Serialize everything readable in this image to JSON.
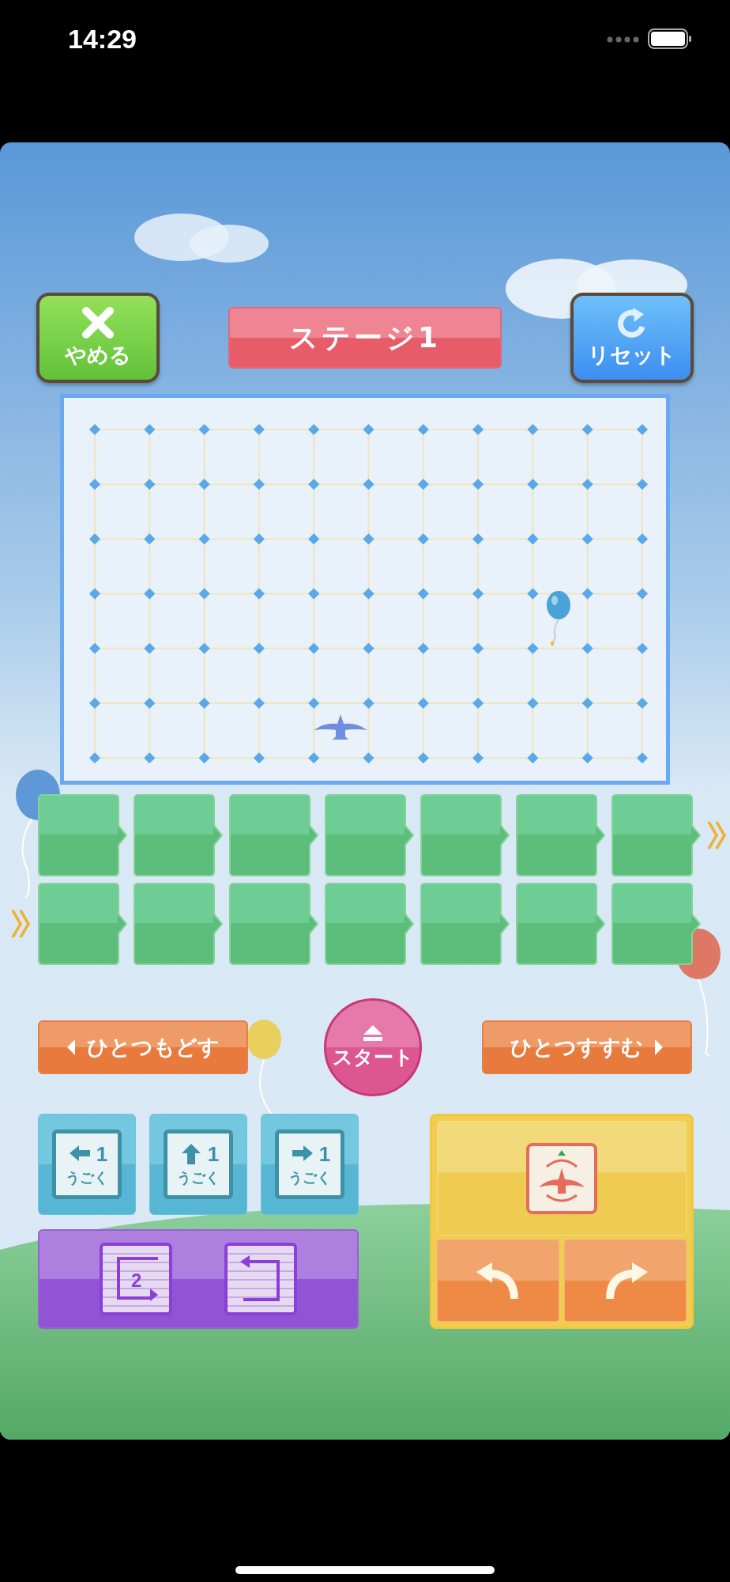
{
  "status_bar": {
    "time": "14:29"
  },
  "header": {
    "quit_button": {
      "label": "やめる"
    },
    "stage_title": "ステージ1",
    "reset_button": {
      "label": "リセット"
    }
  },
  "controls": {
    "step_back": {
      "label": "ひとつもどす"
    },
    "start": {
      "label": "スタート"
    },
    "step_forward": {
      "label": "ひとつすすむ"
    }
  },
  "move_blocks": [
    {
      "kind": "left",
      "count": "1",
      "label": "うごく"
    },
    {
      "kind": "up",
      "count": "1",
      "label": "うごく"
    },
    {
      "kind": "right",
      "count": "1",
      "label": "うごく"
    }
  ],
  "loop_blocks": [
    {
      "kind": "repeat_start",
      "count": "2"
    },
    {
      "kind": "repeat_end"
    }
  ],
  "turn_blocks": [
    {
      "kind": "left"
    },
    {
      "kind": "right"
    }
  ]
}
